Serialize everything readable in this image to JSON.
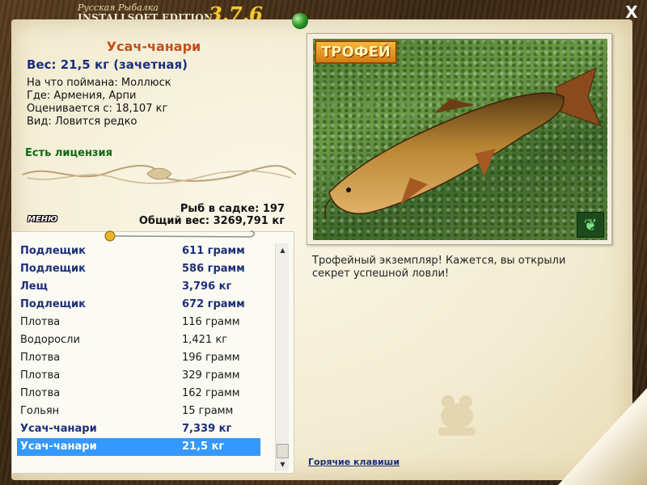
{
  "header": {
    "logo_sub": "Русская Рыбалка",
    "logo_main": "INSTALLSOFT EDITION",
    "version": "3.7.6",
    "close_label": "X"
  },
  "fish": {
    "name": "Усач-чанари",
    "weight_line": "Вес: 21,5 кг (зачетная)",
    "bait_line": "На что поймана: Моллюск",
    "place_line": "Где: Армения, Арпи",
    "value_line": "Оценивается с: 18,107 кг",
    "rarity_line": "Вид: Ловится редко",
    "license": "Есть лицензия"
  },
  "stats": {
    "count_line": "Рыб в садке: 197",
    "total_line": "Общий вес: 3269,791 кг"
  },
  "menu_label": "МЕНЮ",
  "catch_list": [
    {
      "name": "Подлещик",
      "weight": "611 грамм",
      "bold": true
    },
    {
      "name": "Подлещик",
      "weight": "586 грамм",
      "bold": true
    },
    {
      "name": "Лещ",
      "weight": "3,796 кг",
      "bold": true
    },
    {
      "name": "Подлещик",
      "weight": "672 грамм",
      "bold": true
    },
    {
      "name": "Плотва",
      "weight": "116 грамм",
      "bold": false
    },
    {
      "name": "Водоросли",
      "weight": "1,421 кг",
      "bold": false
    },
    {
      "name": "Плотва",
      "weight": "196 грамм",
      "bold": false
    },
    {
      "name": "Плотва",
      "weight": "329 грамм",
      "bold": false
    },
    {
      "name": "Плотва",
      "weight": "162 грамм",
      "bold": false
    },
    {
      "name": "Гольян",
      "weight": "15 грамм",
      "bold": false
    },
    {
      "name": "Усач-чанари",
      "weight": "7,339 кг",
      "bold": true
    },
    {
      "name": "Усач-чанари",
      "weight": "21,5 кг",
      "bold": true,
      "selected": true
    }
  ],
  "photo": {
    "badge": "ТРОФЕЙ",
    "description": "Трофейный экземпляр! Кажется, вы открыли секрет успешной ловли!"
  },
  "hotkeys_label": "Горячие клавиши",
  "colors": {
    "accent_title": "#c0501d",
    "accent_blue": "#1c2f7a",
    "license_green": "#0d6a14",
    "selection": "#3399ff"
  }
}
